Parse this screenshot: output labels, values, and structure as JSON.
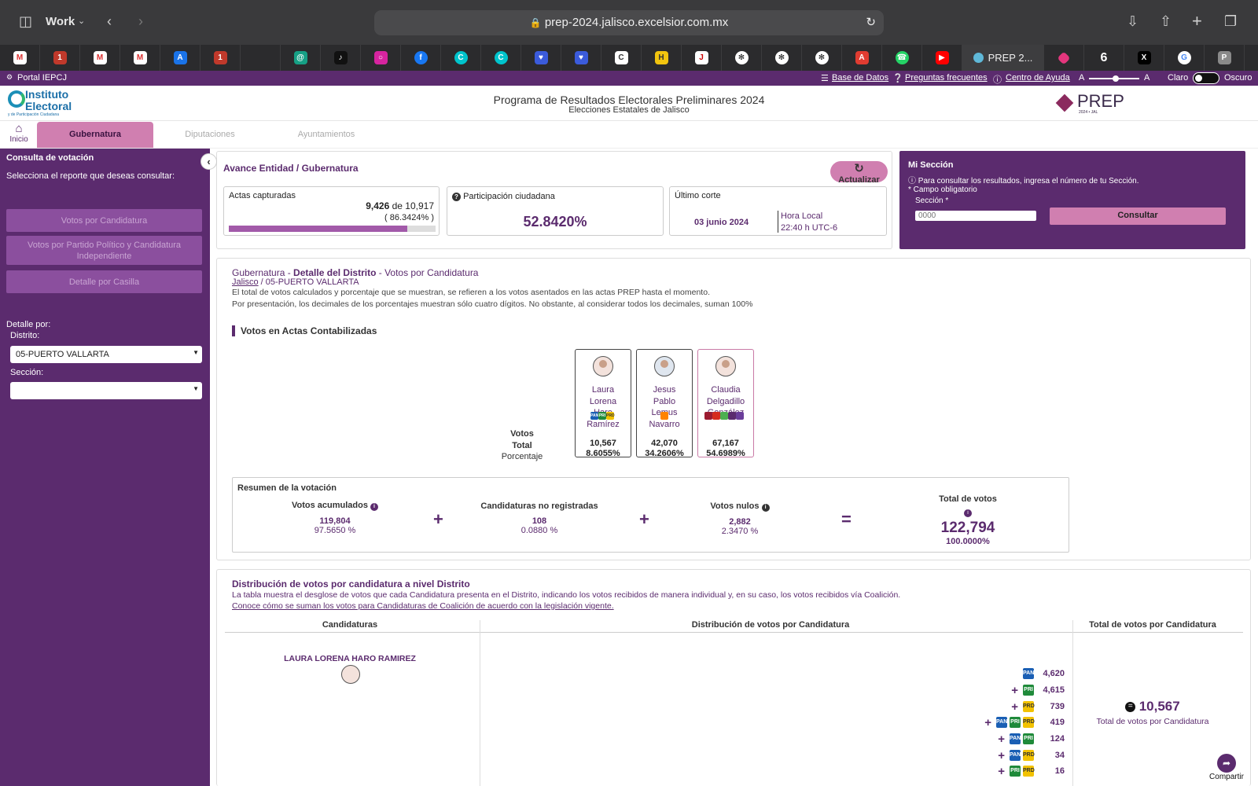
{
  "browser": {
    "profile": "Work",
    "url": "prep-2024.jalisco.excelsior.com.mx",
    "active_tab_title": "PREP 2..."
  },
  "topbar": {
    "portal": "Portal IEPCJ",
    "db": "Base de Datos",
    "faq": "Preguntas frecuentes",
    "help": "Centro de Ayuda",
    "font_small": "A",
    "font_large": "A",
    "light": "Claro",
    "dark": "Oscuro"
  },
  "header": {
    "logo_main": "Instituto Electoral",
    "logo_sub": "y de Participación Ciudadana",
    "title": "Programa de Resultados Electorales Preliminares 2024",
    "subtitle": "Elecciones Estatales de Jalisco",
    "brand": "PREP",
    "brand_sub": "2024 • JAL"
  },
  "nav": {
    "home": "Inicio",
    "tabs": [
      "Gubernatura",
      "Diputaciones",
      "Ayuntamientos"
    ]
  },
  "sidebar": {
    "heading": "Consulta de votación",
    "prompt": "Selecciona el reporte que deseas consultar:",
    "buttons": [
      "Votos por Candidatura",
      "Votos por Partido Político y Candidatura Independiente",
      "Detalle por Casilla"
    ],
    "detail_label": "Detalle por:",
    "district_label": "Distrito:",
    "district_value": "05-PUERTO VALLARTA",
    "section_label": "Sección:",
    "section_value": ""
  },
  "avance": {
    "title": "Avance Entidad / Gubernatura",
    "refresh": "Actualizar",
    "actas_label": "Actas capturadas",
    "actas_count": "9,426",
    "actas_of": "de 10,917",
    "actas_pct": "( 86.3424% )",
    "actas_progress": 0.863424,
    "participation_label": "Participación ciudadana",
    "participation_value": "52.8420%",
    "cut_label": "Último corte",
    "cut_date": "03 junio 2024",
    "cut_local": "Hora Local",
    "cut_time": "22:40 h UTC-6"
  },
  "mi_seccion": {
    "title": "Mi Sección",
    "info": "Para consultar los resultados, ingresa el número de tu Sección.",
    "required": "* Campo obligatorio",
    "field_label": "Sección *",
    "placeholder": "0000",
    "button": "Consultar"
  },
  "detalle": {
    "title_prefix": "Gubernatura - ",
    "title_bold": "Detalle del Distrito",
    "title_suffix": " - Votos por Candidatura",
    "crumb_state": "Jalisco",
    "crumb_district": " / 05-PUERTO VALLARTA",
    "note1": "El total de votos calculados y porcentaje que se muestran, se refieren a los votos asentados en las actas PREP hasta el momento.",
    "note2": "Por presentación, los decimales de los porcentajes muestran sólo cuatro dígitos. No obstante, al considerar todos los decimales, suman 100%",
    "section_title": "Votos en Actas Contabilizadas",
    "label_votos": "Votos",
    "label_total": "Total",
    "label_pct": "Porcentaje",
    "candidates": [
      {
        "name": "Laura Lorena Haro Ramírez",
        "votes": "10,567",
        "pct": "8.6055%"
      },
      {
        "name": "Jesus Pablo Lemus Navarro",
        "votes": "42,070",
        "pct": "34.2606%"
      },
      {
        "name": "Claudia Delgadillo González",
        "votes": "67,167",
        "pct": "54.6989%"
      }
    ]
  },
  "resumen": {
    "title": "Resumen de la votación",
    "acc_label": "Votos acumulados",
    "acc_value": "119,804",
    "acc_pct": "97.5650 %",
    "noreg_label": "Candidaturas no registradas",
    "noreg_value": "108",
    "noreg_pct": "0.0880 %",
    "nulos_label": "Votos nulos",
    "nulos_value": "2,882",
    "nulos_pct": "2.3470 %",
    "total_label": "Total de votos",
    "total_value": "122,794",
    "total_pct": "100.0000%",
    "plus": "+",
    "equals": "="
  },
  "distribucion": {
    "title": "Distribución de votos por candidatura a nivel Distrito",
    "desc": "La tabla muestra el desglose de votos que cada Candidatura presenta en el Distrito, indicando los votos recibidos de manera individual y, en su caso, los votos recibidos vía Coalición.",
    "link": "Conoce cómo se suman los votos para Candidaturas de Coalición de acuerdo con la legislación vigente.",
    "col1": "Candidaturas",
    "col2": "Distribución de votos por Candidatura",
    "col3": "Total de votos por Candidatura",
    "row_name": "LAURA LORENA HARO RAMIREZ",
    "row_total": "10,567",
    "row_total_label": "Total de votos por Candidatura",
    "rows": [
      {
        "parties": "PAN",
        "votes": "4,620"
      },
      {
        "parties": "PRI",
        "votes": "4,615"
      },
      {
        "parties": "PRD",
        "votes": "739"
      },
      {
        "parties": "PAN+PRI+PRD",
        "votes": "419"
      },
      {
        "parties": "PAN+PRI",
        "votes": "124"
      },
      {
        "parties": "PAN+PRD",
        "votes": "34"
      },
      {
        "parties": "PRI+PRD",
        "votes": "16"
      }
    ],
    "share": "Compartir"
  }
}
